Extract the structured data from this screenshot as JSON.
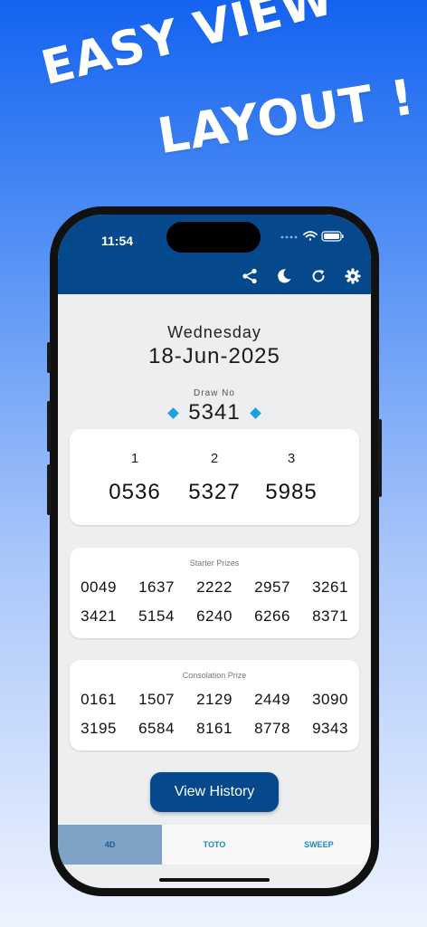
{
  "promo": {
    "line1": "EASY VIEW",
    "line2": "LAYOUT !"
  },
  "status": {
    "time": "11:54"
  },
  "toolbar": {
    "icons": [
      "share-icon",
      "moon-icon",
      "refresh-icon",
      "gear-icon"
    ]
  },
  "draw": {
    "weekday": "Wednesday",
    "date": "18-Jun-2025",
    "draw_no_label": "Draw No",
    "draw_no": "5341"
  },
  "top_prizes": [
    {
      "rank": "1",
      "number": "0536"
    },
    {
      "rank": "2",
      "number": "5327"
    },
    {
      "rank": "3",
      "number": "5985"
    }
  ],
  "starter": {
    "title": "Starter Prizes",
    "numbers": [
      "0049",
      "1637",
      "2222",
      "2957",
      "3261",
      "3421",
      "5154",
      "6240",
      "6266",
      "8371"
    ]
  },
  "consolation": {
    "title": "Consolation Prize",
    "numbers": [
      "0161",
      "1507",
      "2129",
      "2449",
      "3090",
      "3195",
      "6584",
      "8161",
      "8778",
      "9343"
    ]
  },
  "history_button": "View History",
  "tabs": [
    {
      "label": "4D",
      "active": true
    },
    {
      "label": "TOTO",
      "active": false
    },
    {
      "label": "SWEEP",
      "active": false
    }
  ],
  "colors": {
    "primary": "#05498c",
    "accent": "#1ea0e4",
    "tab_active": "#7ea3c7"
  }
}
